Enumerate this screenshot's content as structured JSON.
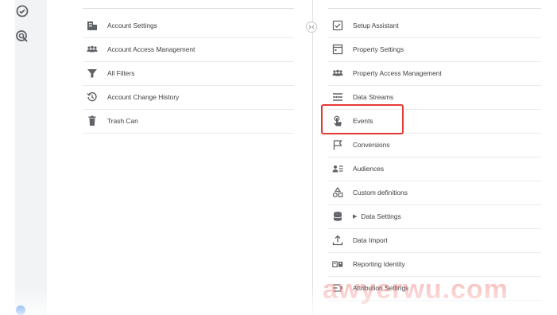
{
  "account_column": {
    "items": [
      {
        "label": "Account Settings",
        "icon": "building-icon"
      },
      {
        "label": "Account Access Management",
        "icon": "people-icon"
      },
      {
        "label": "All Filters",
        "icon": "filter-icon"
      },
      {
        "label": "Account Change History",
        "icon": "history-icon"
      },
      {
        "label": "Trash Can",
        "icon": "trash-icon"
      }
    ]
  },
  "property_column": {
    "items": [
      {
        "label": "Setup Assistant",
        "icon": "checkbox-icon"
      },
      {
        "label": "Property Settings",
        "icon": "property-icon"
      },
      {
        "label": "Property Access Management",
        "icon": "people-icon"
      },
      {
        "label": "Data Streams",
        "icon": "streams-icon"
      },
      {
        "label": "Events",
        "icon": "touch-icon"
      },
      {
        "label": "Conversions",
        "icon": "flag-icon"
      },
      {
        "label": "Audiences",
        "icon": "audience-icon"
      },
      {
        "label": "Custom definitions",
        "icon": "shapes-icon"
      },
      {
        "label": "Data Settings",
        "icon": "database-icon"
      },
      {
        "label": "Data Import",
        "icon": "upload-icon"
      },
      {
        "label": "Reporting Identity",
        "icon": "identity-icon"
      },
      {
        "label": "Attribution Settings",
        "icon": "attribution-icon"
      }
    ]
  },
  "highlighted_item": "Events",
  "watermark": "awyerwu.com",
  "colors": {
    "highlight": "#e53935",
    "icon": "#5f6368",
    "text": "#3c4043",
    "divider": "#e8eaed"
  }
}
